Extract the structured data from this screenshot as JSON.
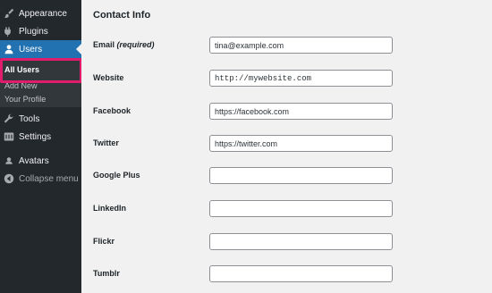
{
  "sidebar": {
    "items": [
      {
        "label": "Appearance",
        "icon": "paintbrush-icon"
      },
      {
        "label": "Plugins",
        "icon": "plug-icon"
      },
      {
        "label": "Users",
        "icon": "users-icon"
      },
      {
        "label": "Tools",
        "icon": "wrench-icon"
      },
      {
        "label": "Settings",
        "icon": "settings-icon"
      },
      {
        "label": "Avatars",
        "icon": "avatars-icon"
      },
      {
        "label": "Collapse menu",
        "icon": "collapse-icon"
      }
    ],
    "submenu": [
      {
        "label": "All Users"
      },
      {
        "label": "Add New"
      },
      {
        "label": "Your Profile"
      }
    ],
    "colors": {
      "background": "#23282d",
      "active": "#2271b1",
      "highlight": "#e01d6d"
    }
  },
  "main": {
    "title": "Contact Info",
    "fields": [
      {
        "label": "Email",
        "note": "(required)",
        "value": "tina@example.com"
      },
      {
        "label": "Website",
        "value": "http://mywebsite.com"
      },
      {
        "label": "Facebook",
        "value": "https://facebook.com"
      },
      {
        "label": "Twitter",
        "value": "https://twitter.com"
      },
      {
        "label": "Google Plus",
        "value": ""
      },
      {
        "label": "LinkedIn",
        "value": ""
      },
      {
        "label": "Flickr",
        "value": ""
      },
      {
        "label": "Tumblr",
        "value": ""
      }
    ]
  }
}
